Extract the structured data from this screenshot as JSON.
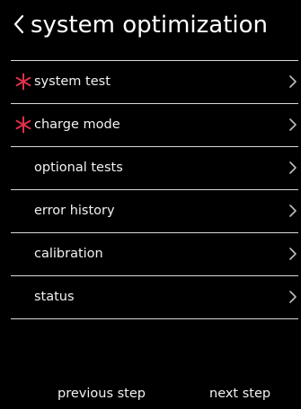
{
  "header": {
    "title": "system optimization",
    "back_icon": "chevron-left-icon"
  },
  "menu": {
    "items": [
      {
        "label": "system test",
        "required": true,
        "icon": "asterisk-icon",
        "chevron": "chevron-right-icon"
      },
      {
        "label": "charge mode",
        "required": true,
        "icon": "asterisk-icon",
        "chevron": "chevron-right-icon"
      },
      {
        "label": "optional tests",
        "required": false,
        "chevron": "chevron-right-icon"
      },
      {
        "label": "error history",
        "required": false,
        "chevron": "chevron-right-icon"
      },
      {
        "label": "calibration",
        "required": false,
        "chevron": "chevron-right-icon"
      },
      {
        "label": "status",
        "required": false,
        "chevron": "chevron-right-icon"
      }
    ]
  },
  "footer": {
    "previous_label": "previous step",
    "next_label": "next step"
  },
  "colors": {
    "background": "#000000",
    "text": "#f2f2f2",
    "required_marker": "#e0304a",
    "divider": "#d9d9d9"
  }
}
